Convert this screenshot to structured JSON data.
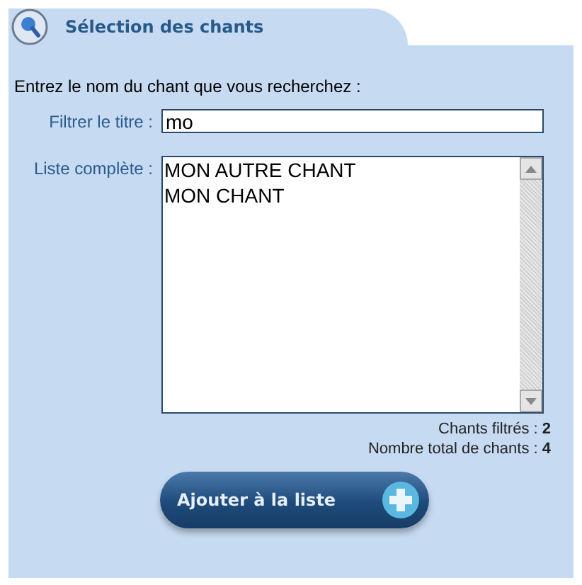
{
  "panel": {
    "title": "Sélection des chants"
  },
  "intro": "Entrez le nom du chant que vous recherchez :",
  "filter": {
    "label": "Filtrer le titre :",
    "value": "mo"
  },
  "list": {
    "label": "Liste complète :",
    "items": [
      {
        "text": "MON AUTRE CHANT",
        "selected": false
      },
      {
        "text": "MON CHANT",
        "selected": false
      }
    ]
  },
  "counts": [
    "Chants filtrés : **2**",
    "Nombre total de chants : **4**"
  ],
  "button": "Ajouter à la liste"
}
